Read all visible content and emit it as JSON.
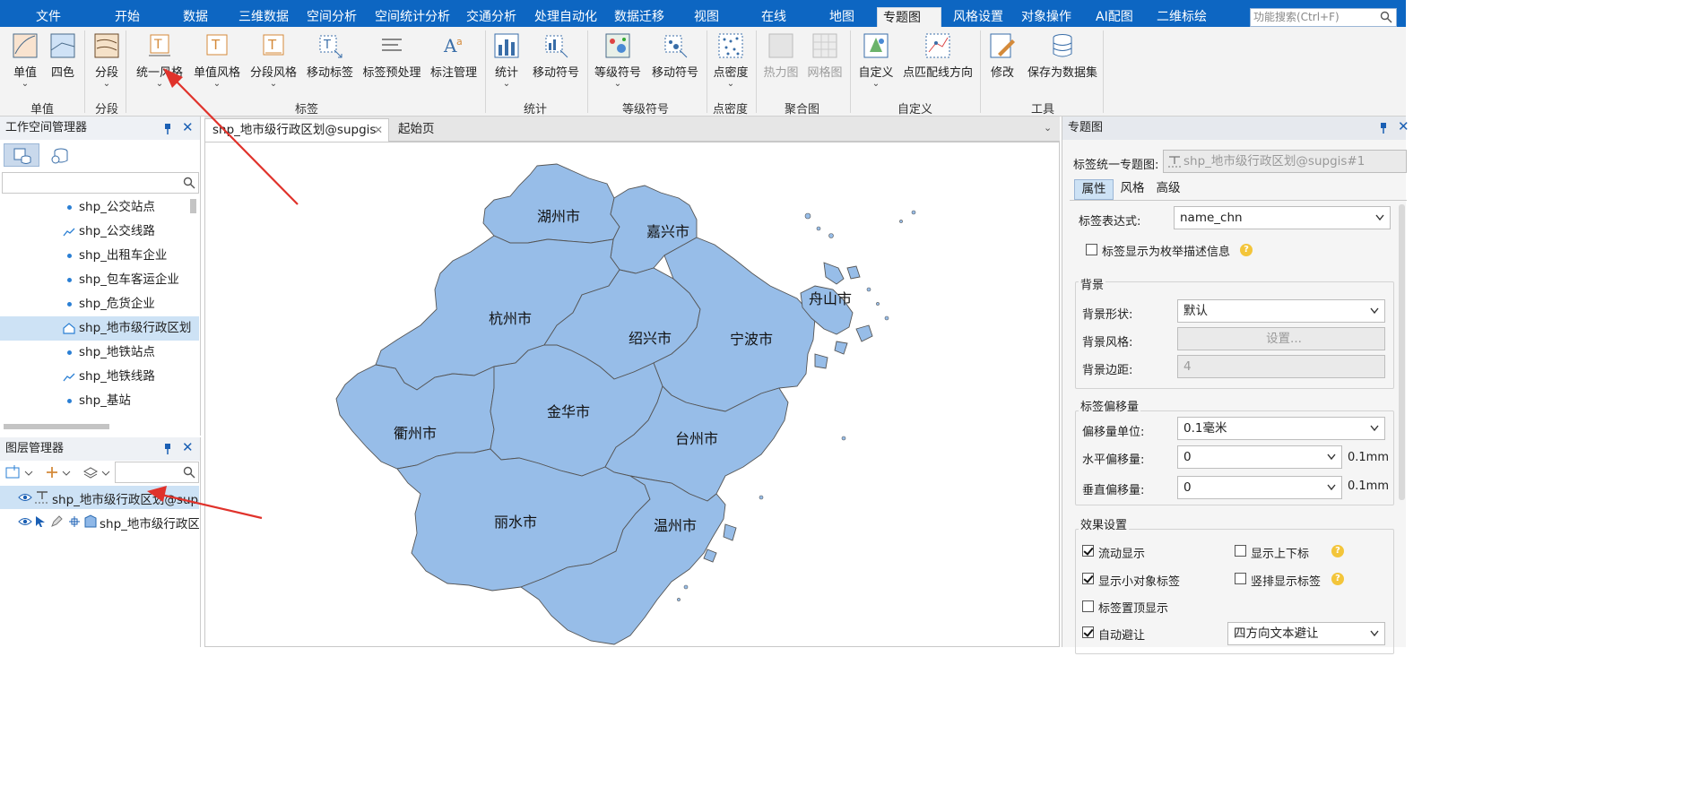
{
  "menubar": {
    "items": [
      "文件",
      "开始",
      "数据",
      "三维数据",
      "空间分析",
      "空间统计分析",
      "交通分析",
      "处理自动化",
      "数据迁移",
      "视图",
      "在线",
      "地图",
      "专题图",
      "风格设置",
      "对象操作",
      "AI配图",
      "二维标绘"
    ],
    "active": "专题图",
    "search_placeholder": "功能搜索(Ctrl+F)"
  },
  "ribbon": {
    "buttons": [
      {
        "label": "单值",
        "icon": "unique-value-icon"
      },
      {
        "label": "四色",
        "icon": "four-color-icon"
      },
      {
        "label": "分段",
        "icon": "range-icon"
      },
      {
        "label": "统一风格",
        "icon": "label-uniform-icon"
      },
      {
        "label": "单值风格",
        "icon": "label-unique-icon"
      },
      {
        "label": "分段风格",
        "icon": "label-range-icon"
      },
      {
        "label": "移动标签",
        "icon": "move-label-icon"
      },
      {
        "label": "标签预处理",
        "icon": "label-preprocess-icon"
      },
      {
        "label": "标注管理",
        "icon": "annotation-manage-icon"
      },
      {
        "label": "统计",
        "icon": "graph-icon"
      },
      {
        "label": "移动符号",
        "icon": "move-symbol-icon"
      },
      {
        "label": "等级符号",
        "icon": "graduated-symbol-icon"
      },
      {
        "label": "移动符号",
        "icon": "move-symbol-2-icon"
      },
      {
        "label": "点密度",
        "icon": "dot-density-icon"
      },
      {
        "label": "热力图",
        "icon": "heatmap-icon"
      },
      {
        "label": "网格图",
        "icon": "grid-map-icon"
      },
      {
        "label": "自定义",
        "icon": "custom-icon"
      },
      {
        "label": "点匹配线方向",
        "icon": "point-line-direction-icon"
      },
      {
        "label": "修改",
        "icon": "modify-icon"
      },
      {
        "label": "保存为数据集",
        "icon": "save-dataset-icon"
      }
    ],
    "groups": [
      "单值",
      "分段",
      "标签",
      "统计",
      "等级符号",
      "点密度",
      "聚合图",
      "自定义",
      "工具"
    ]
  },
  "workspace": {
    "title": "工作空间管理器",
    "items": [
      "shp_公交站点",
      "shp_公交线路",
      "shp_出租车企业",
      "shp_包车客运企业",
      "shp_危货企业",
      "shp_地市级行政区划",
      "shp_地铁站点",
      "shp_地铁线路",
      "shp_基站"
    ],
    "selected_index": 5
  },
  "layers": {
    "title": "图层管理器",
    "items": [
      "shp_地市级行政区划@supgis",
      "shp_地市级行政区划"
    ]
  },
  "map": {
    "tabs": [
      "shp_地市级行政区划@supgis",
      "起始页"
    ],
    "cities": [
      "湖州市",
      "嘉兴市",
      "杭州市",
      "绍兴市",
      "宁波市",
      "舟山市",
      "金华市",
      "衢州市",
      "台州市",
      "丽水市",
      "温州市"
    ],
    "fill_color": "#97bde8",
    "stroke_color": "#555555"
  },
  "right_panel": {
    "title": "专题图",
    "theme_label": "标签统一专题图:",
    "theme_value": "shp_地市级行政区划@supgis#1",
    "tabs": [
      "属性",
      "风格",
      "高级"
    ],
    "expression_label": "标签表达式:",
    "expression_value": "name_chn",
    "enum_desc_label": "标签显示为枚举描述信息",
    "background": {
      "title": "背景",
      "shape_label": "背景形状:",
      "shape_value": "默认",
      "style_label": "背景风格:",
      "style_value": "设置...",
      "margin_label": "背景边距:",
      "margin_value": "4"
    },
    "offset": {
      "title": "标签偏移量",
      "unit_label": "偏移量单位:",
      "unit_value": "0.1毫米",
      "h_label": "水平偏移量:",
      "h_value": "0",
      "h_unit": "0.1mm",
      "v_label": "垂直偏移量:",
      "v_value": "0",
      "v_unit": "0.1mm"
    },
    "effects": {
      "title": "效果设置",
      "flow": "流动显示",
      "flow_checked": true,
      "superscript": "显示上下标",
      "superscript_checked": false,
      "small_obj": "显示小对象标签",
      "small_obj_checked": true,
      "vertical": "竖排显示标签",
      "vertical_checked": false,
      "top": "标签置顶显示",
      "top_checked": false,
      "avoid": "自动避让",
      "avoid_checked": true,
      "avoid_mode": "四方向文本避让"
    }
  },
  "annotation_color": "#e0322b"
}
